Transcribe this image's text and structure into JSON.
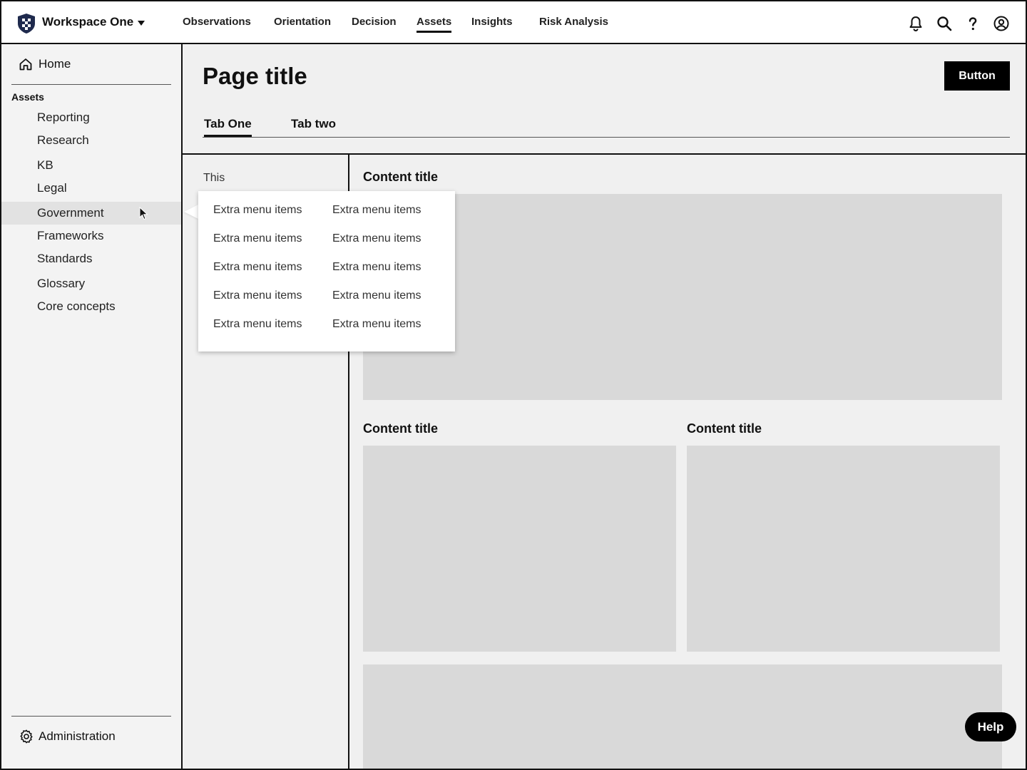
{
  "topbar": {
    "workspace": "Workspace One",
    "nav": [
      {
        "label": "Observations"
      },
      {
        "label": "Orientation"
      },
      {
        "label": "Decision"
      },
      {
        "label": "Assets",
        "active": true
      },
      {
        "label": "Insights"
      },
      {
        "label": "Risk Analysis"
      }
    ],
    "icons": [
      "bell-icon",
      "search-icon",
      "help-icon",
      "account-icon"
    ]
  },
  "sidebar": {
    "home": "Home",
    "section": "Assets",
    "items": [
      {
        "label": "Reporting"
      },
      {
        "label": "Research"
      },
      {
        "label": "KB"
      },
      {
        "label": "Legal"
      },
      {
        "label": "Government",
        "hovered": true
      },
      {
        "label": "Frameworks"
      },
      {
        "label": "Standards"
      },
      {
        "label": "Glossary"
      },
      {
        "label": "Core concepts"
      }
    ],
    "admin": "Administration"
  },
  "header": {
    "title": "Page title",
    "button": "Button",
    "tabs": [
      {
        "label": "Tab One",
        "active": true
      },
      {
        "label": "Tab two"
      }
    ]
  },
  "subpanel": {
    "text": "This"
  },
  "flyout": {
    "items": [
      "Extra menu items",
      "Extra menu items",
      "Extra menu items",
      "Extra menu items",
      "Extra menu items",
      "Extra menu items",
      "Extra menu items",
      "Extra menu items",
      "Extra menu items",
      "Extra menu items"
    ]
  },
  "content": {
    "titles": [
      "Content title",
      "Content title",
      "Content title"
    ]
  },
  "help_button": "Help",
  "colors": {
    "accent": "#000000",
    "sidebar_bg": "#f3f3f3",
    "hover_bg": "#e2e2e2",
    "placeholder": "#d9d9d9",
    "page_bg": "#f0f0f0"
  }
}
